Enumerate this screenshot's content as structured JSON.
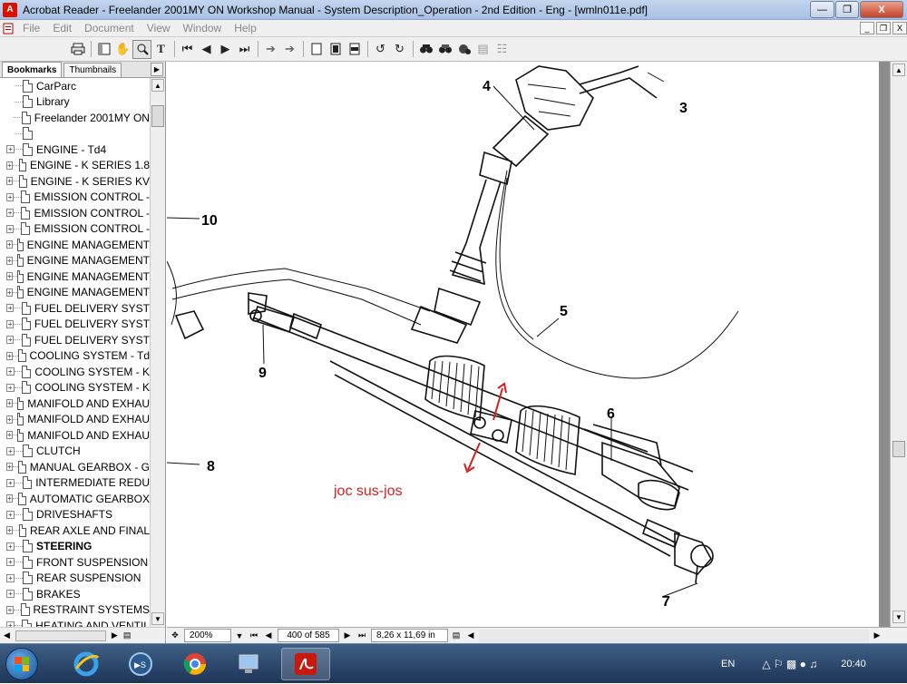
{
  "window": {
    "title": "Acrobat Reader - Freelander 2001MY ON Workshop Manual - System Description_Operation - 2nd Edition - Eng - [wmln011e.pdf]"
  },
  "menu": [
    "File",
    "Edit",
    "Document",
    "View",
    "Window",
    "Help"
  ],
  "toolbar_icons": [
    "print-icon",
    "show-hide-navigation-icon",
    "hand-tool-icon",
    "zoom-tool-icon",
    "text-select-icon",
    "first-page-icon",
    "previous-page-icon",
    "next-page-icon",
    "last-page-icon",
    "go-back-icon",
    "go-forward-icon",
    "actual-size-icon",
    "fit-page-icon",
    "fit-width-icon",
    "rotate-left-icon",
    "rotate-right-icon",
    "find-icon",
    "search-icon",
    "web-icon",
    "reflow-icon",
    "article-icon"
  ],
  "sidebar": {
    "tabs": [
      "Bookmarks",
      "Thumbnails"
    ],
    "bookmarks": [
      {
        "label": "CarParc",
        "expandable": false,
        "bold": false
      },
      {
        "label": "Library",
        "expandable": false,
        "bold": false
      },
      {
        "label": "Freelander 2001MY ON",
        "expandable": false,
        "bold": false
      },
      {
        "label": "",
        "expandable": false,
        "bold": false
      },
      {
        "label": "ENGINE - Td4",
        "expandable": true,
        "bold": false
      },
      {
        "label": "ENGINE - K SERIES 1.8",
        "expandable": true,
        "bold": false
      },
      {
        "label": "ENGINE - K SERIES KV",
        "expandable": true,
        "bold": false
      },
      {
        "label": "EMISSION CONTROL -",
        "expandable": true,
        "bold": false
      },
      {
        "label": "EMISSION CONTROL -",
        "expandable": true,
        "bold": false
      },
      {
        "label": "EMISSION CONTROL -",
        "expandable": true,
        "bold": false
      },
      {
        "label": "ENGINE MANAGEMENT",
        "expandable": true,
        "bold": false
      },
      {
        "label": "ENGINE MANAGEMENT",
        "expandable": true,
        "bold": false
      },
      {
        "label": "ENGINE MANAGEMENT",
        "expandable": true,
        "bold": false
      },
      {
        "label": "ENGINE MANAGEMENT",
        "expandable": true,
        "bold": false
      },
      {
        "label": "FUEL DELIVERY SYST",
        "expandable": true,
        "bold": false
      },
      {
        "label": "FUEL DELIVERY SYST",
        "expandable": true,
        "bold": false
      },
      {
        "label": "FUEL DELIVERY SYST",
        "expandable": true,
        "bold": false
      },
      {
        "label": "COOLING SYSTEM - Td",
        "expandable": true,
        "bold": false
      },
      {
        "label": "COOLING SYSTEM - K",
        "expandable": true,
        "bold": false
      },
      {
        "label": "COOLING SYSTEM - K",
        "expandable": true,
        "bold": false
      },
      {
        "label": "MANIFOLD AND EXHAU",
        "expandable": true,
        "bold": false
      },
      {
        "label": "MANIFOLD AND EXHAU",
        "expandable": true,
        "bold": false
      },
      {
        "label": "MANIFOLD AND EXHAU",
        "expandable": true,
        "bold": false
      },
      {
        "label": "CLUTCH",
        "expandable": true,
        "bold": false
      },
      {
        "label": "MANUAL GEARBOX - G",
        "expandable": true,
        "bold": false
      },
      {
        "label": "INTERMEDIATE REDU",
        "expandable": true,
        "bold": false
      },
      {
        "label": "AUTOMATIC GEARBOX",
        "expandable": true,
        "bold": false
      },
      {
        "label": "DRIVESHAFTS",
        "expandable": true,
        "bold": false
      },
      {
        "label": "REAR AXLE AND FINAL",
        "expandable": true,
        "bold": false
      },
      {
        "label": "STEERING",
        "expandable": true,
        "bold": true
      },
      {
        "label": "FRONT SUSPENSION",
        "expandable": true,
        "bold": false
      },
      {
        "label": "REAR SUSPENSION",
        "expandable": true,
        "bold": false
      },
      {
        "label": "BRAKES",
        "expandable": true,
        "bold": false
      },
      {
        "label": "RESTRAINT SYSTEMS",
        "expandable": true,
        "bold": false
      },
      {
        "label": "HEATING AND VENTIL",
        "expandable": true,
        "bold": false
      }
    ]
  },
  "document": {
    "callouts": [
      "4",
      "3",
      "10",
      "5",
      "9",
      "6",
      "8",
      "7"
    ],
    "annotation_text": "joc sus-jos",
    "annotation_color": "#d42020"
  },
  "status": {
    "zoom": "200%",
    "page": "400 of 585",
    "page_size": "8,26 x 11,69 in"
  },
  "taskbar": {
    "apps": [
      "internet-explorer-icon",
      "media-app-icon",
      "chrome-icon",
      "computer-icon",
      "acrobat-icon"
    ],
    "language": "EN",
    "time": "20:40"
  }
}
